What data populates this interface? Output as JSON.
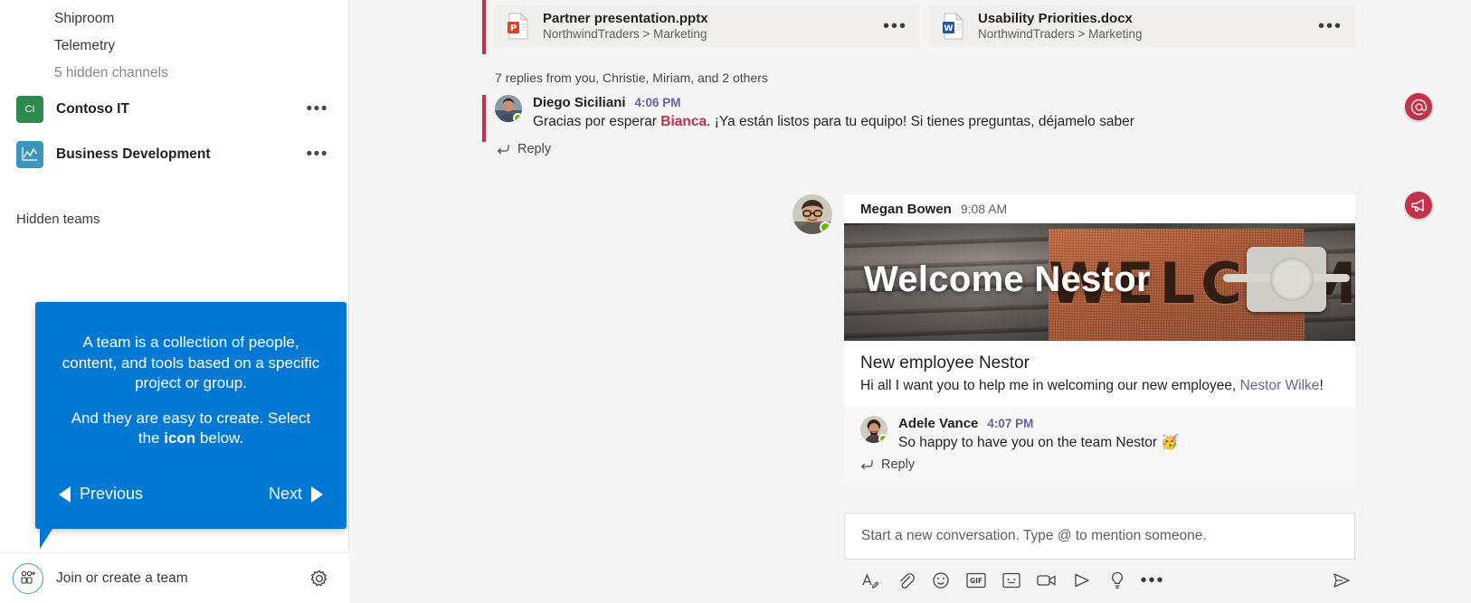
{
  "sidebar": {
    "channels": [
      {
        "label": "Shiproom",
        "muted": false
      },
      {
        "label": "Telemetry",
        "muted": false
      },
      {
        "label": "5 hidden channels",
        "muted": true
      }
    ],
    "teams": [
      {
        "name": "Contoso IT",
        "initials": "CI",
        "color": "#2d8a4e",
        "more": "•••"
      },
      {
        "name": "Business Development",
        "initials": "",
        "color": "#3a96bd",
        "more": "•••"
      }
    ],
    "hidden_teams_label": "Hidden teams",
    "footer": {
      "join_label": "Join or create a team",
      "join_icon": "add-team-icon",
      "settings_icon": "gear-icon"
    }
  },
  "callout": {
    "paragraph_one": "A team is a collection of people, content, and tools based on a specific project or group.",
    "paragraph_two_prefix": "And they are easy to create. Select the ",
    "paragraph_two_bold": "icon",
    "paragraph_two_suffix": " below.",
    "previous_label": "Previous",
    "next_label": "Next",
    "background_color": "#0078d4"
  },
  "files": [
    {
      "name": "Partner presentation.pptx",
      "path": "NorthwindTraders > Marketing",
      "type": "powerpoint",
      "icon": "powerpoint-file-icon",
      "more": "•••"
    },
    {
      "name": "Usability Priorities.docx",
      "path": "NorthwindTraders > Marketing",
      "type": "word",
      "icon": "word-file-icon",
      "more": "•••"
    }
  ],
  "thread": {
    "replies_summary": "7 replies from you, Christie, Miriam, and 2 others",
    "accent_color": "#c4314b",
    "message": {
      "author": "Diego Siciliani",
      "time": "4:06 PM",
      "text_before": "Gracias por esperar ",
      "mention": "Bianca",
      "text_after": ". ¡Ya están listos para tu equipo! Si tienes preguntas, déjamelo saber",
      "reply_label": "Reply"
    }
  },
  "post": {
    "author": "Megan Bowen",
    "time": "9:08 AM",
    "banner": {
      "overlay_title": "Welcome Nestor",
      "mat_word": "WELCOME"
    },
    "title": "New employee Nestor",
    "body_prefix": "Hi all I want you to help me in welcoming our new employee, ",
    "body_link": "Nestor Wilke",
    "body_suffix": "!",
    "reply": {
      "author": "Adele Vance",
      "time": "4:07 PM",
      "text": "So happy to have you on the team Nestor 🥳",
      "reply_label": "Reply"
    }
  },
  "compose": {
    "placeholder": "Start a new conversation. Type @ to mention someone.",
    "tools": [
      {
        "name": "format-icon"
      },
      {
        "name": "attach-icon"
      },
      {
        "name": "emoji-icon"
      },
      {
        "name": "giphy-icon",
        "label": "GIF"
      },
      {
        "name": "sticker-icon"
      },
      {
        "name": "meet-now-icon"
      },
      {
        "name": "stream-icon"
      },
      {
        "name": "praise-icon"
      },
      {
        "name": "more-options-icon",
        "label": "•••"
      }
    ],
    "send_icon": "send-icon"
  },
  "badges": [
    {
      "name": "mention-badge",
      "glyph": "@",
      "color": "#c4314b"
    },
    {
      "name": "announcement-badge",
      "glyph": "megaphone",
      "color": "#c4314b"
    }
  ]
}
